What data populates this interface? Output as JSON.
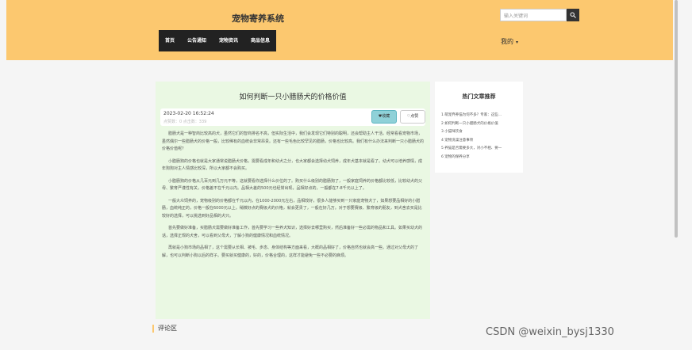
{
  "header": {
    "site_title": "宠物寄养系统",
    "search_placeholder": "输入关键词",
    "nav": [
      "首页",
      "公告通知",
      "宠物资讯",
      "商品信息"
    ],
    "my_menu": "我的"
  },
  "article": {
    "title": "如何判断一只小腊肠犬的价格价值",
    "date": "2023-02-20 16:52:24",
    "stats": "点赞数：0   点击数：339",
    "fav_label": "收藏",
    "like_label": "点赞",
    "paragraphs": [
      "腊肠犬是一种智商比较高的犬，虽然它们的智商排名不高，但实际生活中，我们会发现它们特别的聪明，还会帮助主人干活。经常看看宠物市场，虽然偶尔一些腊肠犬的价格一般，比较稀有的血统会非常昂贵。还有一些毛色比较罕见的腊肠，价格也比较高。我们有什么办法来判断一只小腊肠犬的价格价值呢？",
      "小腊肠狗的价格也就是大家通常说腊肠犬价格，需要看成年和幼犬之分，也大家都会选择幼犬饲养，成年犬基本就是看了。幼犬可以培养感情，成年狗狗对主人情感比较深，所以大家都不会购买。",
      "小腊肠狗的价格从几百元到几万元不等，这就要看你选择什么价位的了。购买什么级别的腊肠狗了，一般家庭饲养的价格都比较低，比较幼犬的父母、繁育严谨性有关，价格差不在千元以内。品相大差的500元也经常出现，品相好点的，一般都在7-8千元以上了。",
      "一般大众饲养的，宠物级别的价格都在千元以内，在1000-2000元左右，品相较好，很多人能够买到一只家庭宠物犬了，如果想要品相好的小腊肠，血统纯正的，价格一般在6000元以上。稍微好点的赛级犬的价格，就会更贵了，一般在好几万。对于想要赛级、繁育级的朋友，到犬舍去买是比较好的选择，可以挑选到好品相的犬只。",
      "首先要做好准备，买腊肠犬需要做好准备工作，首先要学习一些养犬知识，选择好去哪里购买，然后准备好一些必需的物品和工具。如果买幼犬的话，选择正规的犬舍，可以看到父母犬，了解小狗的健康情况和血统情况。",
      "再就是小狗市场的品相了，这个需要从长相、被毛、步态、身体结构等方面来看，大概的品相好了，价格自然也就会高一些。通过对父母犬的了解，也可以判断小狗以后的样子。要买就买健康的，好的，价格合理的，这样才能避免一些不必要的麻烦。"
    ]
  },
  "hot": {
    "title": "热门文章推荐",
    "items": [
      "1  萌宠弃养猫为何不多？专家：这些...",
      "2  如何判断一只小腊肠犬的价格价值",
      "3  小猫咪饮食",
      "4  宠物洗澡注意事项",
      "5  养猫是否需要多大，对小不相、要一",
      "6  宠物的保养分享"
    ]
  },
  "comment_label": "评论区",
  "watermark": "CSDN @weixin_bysj1330",
  "colors": {
    "header_bg": "#fcc86f",
    "nav_bg": "#222222",
    "article_bg": "#eaf8e3",
    "fav_button_bg": "#8fd1d8"
  }
}
